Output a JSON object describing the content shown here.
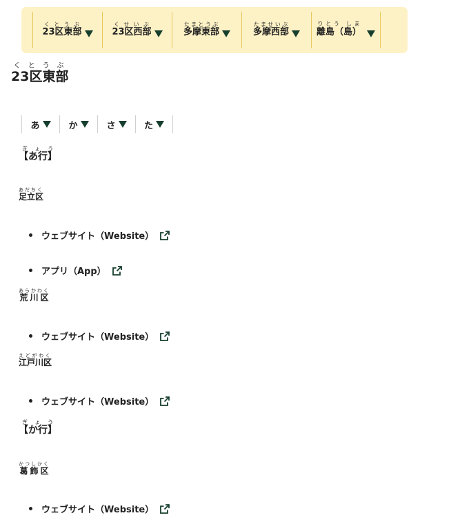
{
  "region_nav": [
    {
      "label": "23区東部",
      "ruby_base": [
        "23区",
        "東部"
      ],
      "ruby": "くとうぶ"
    },
    {
      "label": "23区西部",
      "ruby_base": [
        "23区",
        "西部"
      ],
      "ruby": "くせいぶ"
    },
    {
      "label": "多摩東部",
      "ruby": "たまとうぶ"
    },
    {
      "label": "多摩西部",
      "ruby": "たませいぶ"
    },
    {
      "label": "離島（島）",
      "ruby": "りとう しま"
    }
  ],
  "page_title": {
    "text": "23区東部",
    "ruby": "くとうぶ"
  },
  "kana_nav": [
    "あ",
    "か",
    "さ",
    "た"
  ],
  "sections": [
    {
      "heading": "【あ行】",
      "heading_ruby": "ぎょう",
      "wards": [
        {
          "name": "足立区",
          "ruby": "あだちく",
          "links": [
            "ウェブサイト（Website）",
            "アプリ（App）"
          ]
        },
        {
          "name": "荒川区",
          "ruby": "あらかわく",
          "links": [
            "ウェブサイト（Website）"
          ]
        },
        {
          "name": "江戸川区",
          "ruby": "えどがわく",
          "links": [
            "ウェブサイト（Website）"
          ]
        }
      ]
    },
    {
      "heading": "【か行】",
      "heading_ruby": "ぎょう",
      "wards": [
        {
          "name": "葛飾区",
          "ruby": "かつしかく",
          "links": [
            "ウェブサイト（Website）"
          ]
        }
      ]
    }
  ],
  "colors": {
    "nav_bg": "#fdf2c6",
    "nav_divider": "#e7c558",
    "accent": "#173f2d"
  },
  "icons": {
    "dropdown": "triangle-down-icon",
    "external": "external-link-icon"
  }
}
